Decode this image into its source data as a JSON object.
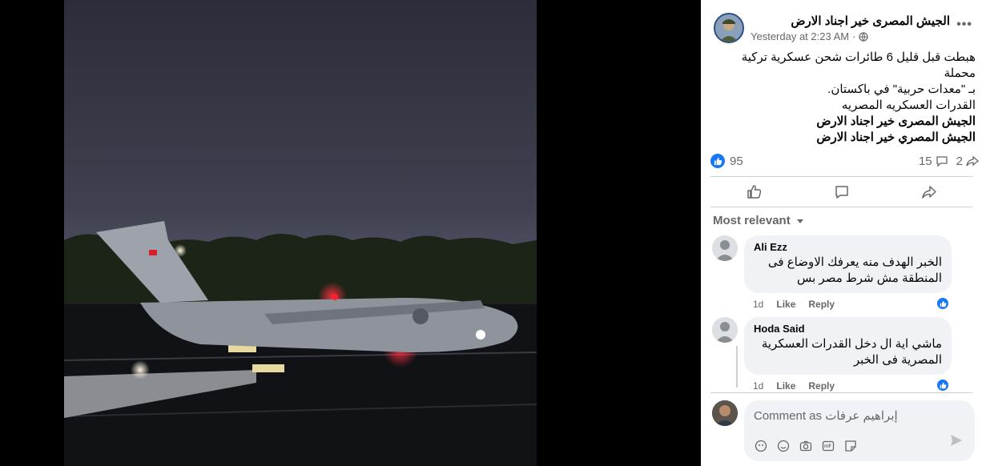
{
  "post": {
    "author": "الجيش المصرى خير اجناد الارض",
    "time": "Yesterday at 2:23 AM",
    "privacy_dot": "·",
    "text_lines": [
      "هبطت قبل قليل 6 طائرات شحن عسكرية تركية محملة",
      "بـ \"معدات حربية\" في باكستان.",
      "القدرات العسكريه المصريه"
    ],
    "bold_lines": [
      "الجيش المصرى خير اجناد الارض",
      "الجيش المصري خير اجناد الارض"
    ]
  },
  "stats": {
    "likes": "95",
    "comments": "15",
    "shares": "2"
  },
  "sort_label": "Most relevant",
  "comments": [
    {
      "name": "Ali Ezz",
      "text": "الخبر الهدف منه يعرفك الاوضاع فى المنطقة مش شرط مصر بس",
      "time": "1d",
      "like": "Like",
      "reply": "Reply"
    },
    {
      "name": "Hoda Said",
      "text": "ماشي اية ال دخل القدرات العسكرية المصرية فى الخبر",
      "time": "1d",
      "like": "Like",
      "reply": "Reply"
    }
  ],
  "composer": {
    "placeholder": "Comment as إبراهيم عرفات"
  },
  "colors": {
    "accent": "#1877f2",
    "muted": "#65676b",
    "bubble": "#f0f2f5"
  }
}
